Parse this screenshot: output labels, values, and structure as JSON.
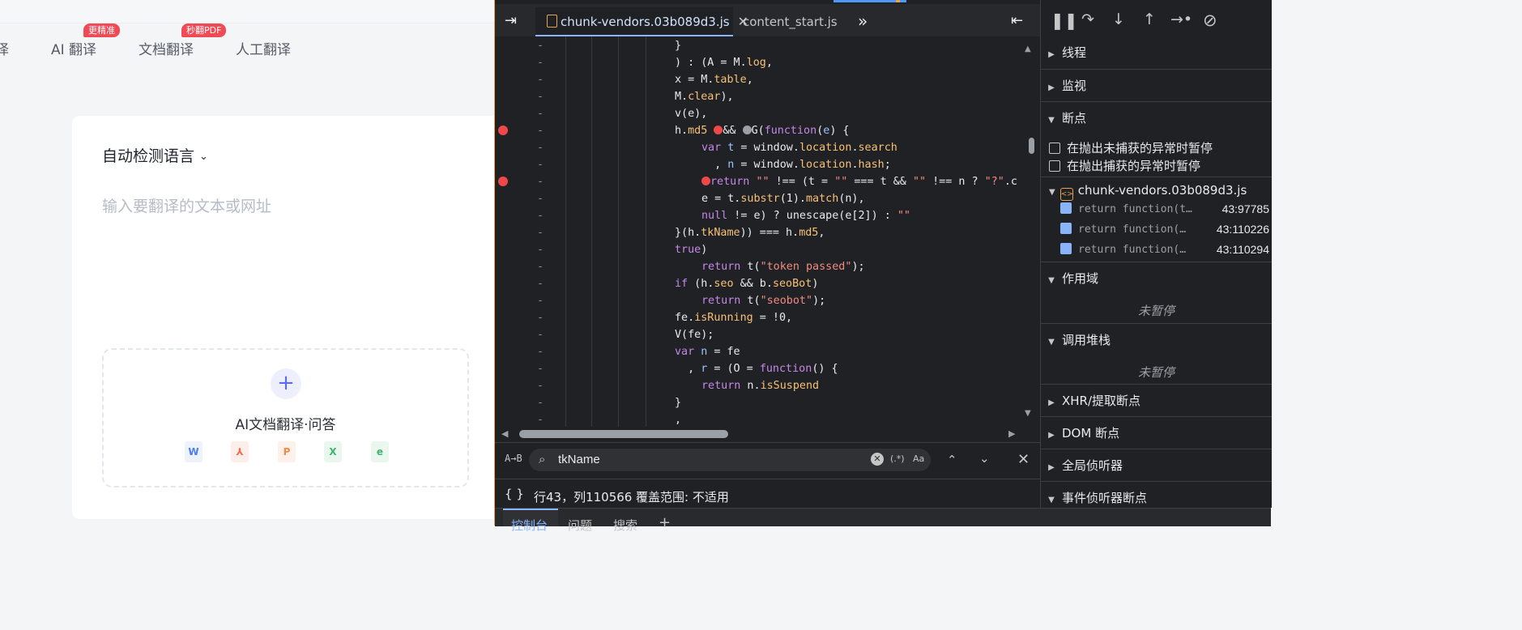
{
  "web": {
    "nav_partial": "译",
    "nav_tabs": [
      {
        "label": "AI 翻译",
        "badge": "更精准"
      },
      {
        "label": "文档翻译",
        "badge": "秒翻PDF"
      },
      {
        "label": "人工翻译",
        "badge": ""
      }
    ],
    "lang_select": "自动检测语言",
    "source_placeholder": "输入要翻译的文本或网址",
    "upload_plus": "+",
    "upload_label": "AI文档翻译·问答",
    "file_types": [
      {
        "name": "word",
        "glyph": "W",
        "color": "#4a7cf3"
      },
      {
        "name": "pdf",
        "glyph": "⅄",
        "color": "#f06c4a"
      },
      {
        "name": "ppt",
        "glyph": "P",
        "color": "#f08a4a"
      },
      {
        "name": "excel",
        "glyph": "X",
        "color": "#3fb66b"
      },
      {
        "name": "epub",
        "glyph": "e",
        "color": "#3fb66b"
      }
    ]
  },
  "devtools": {
    "active_file_tab": "chunk-vendors.03b089d3.js",
    "second_file_tab": "content_start.js",
    "gutter_marker": "-",
    "search_query": "tkName",
    "search_regex_label": "(.*)",
    "search_case_label": "Aa",
    "status_braces": "{ }",
    "status_position": "行43，列110566",
    "status_coverage": "覆盖范围: 不适用",
    "drawer_tabs": [
      "控制台",
      "问题",
      "搜索",
      "+"
    ],
    "sidebar": {
      "threads": "线程",
      "watch": "监视",
      "breakpoints": "断点",
      "pause_uncaught": "在抛出未捕获的异常时暂停",
      "pause_caught": "在抛出捕获的异常时暂停",
      "bp_file": "chunk-vendors.03b089d3.js",
      "bp_entries": [
        {
          "code": "return function(t…",
          "loc": "43:97785"
        },
        {
          "code": "return function(…",
          "loc": "43:110226"
        },
        {
          "code": "return function(…",
          "loc": "43:110294"
        }
      ],
      "scope": "作用域",
      "not_paused": "未暂停",
      "call_stack": "调用堆栈",
      "not_paused_2": "未暂停",
      "xhr_breakpoints": "XHR/提取断点",
      "dom_breakpoints": "DOM 断点",
      "global_listeners": "全局侦听器",
      "event_listener_bps": "事件侦听器断点"
    }
  }
}
